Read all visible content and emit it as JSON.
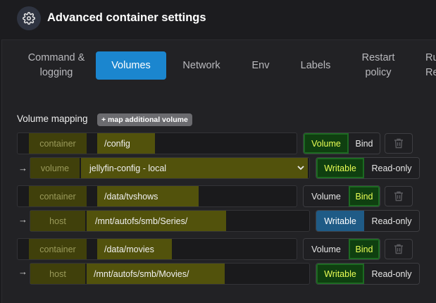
{
  "header": {
    "title": "Advanced container settings",
    "icon": "gear-icon"
  },
  "tabs": [
    {
      "label": "Command &\nlogging",
      "active": false
    },
    {
      "label": "Volumes",
      "active": true
    },
    {
      "label": "Network",
      "active": false
    },
    {
      "label": "Env",
      "active": false
    },
    {
      "label": "Labels",
      "active": false
    },
    {
      "label": "Restart\npolicy",
      "active": false
    },
    {
      "label": "Ru\nRe",
      "active": false
    }
  ],
  "volumes": {
    "section_label": "Volume mapping",
    "add_label": "+ map additional volume",
    "mappings": [
      {
        "container_label": "container",
        "container_path": "/config",
        "type_options": [
          "Volume",
          "Bind"
        ],
        "type_selected": "Volume",
        "source_label": "volume",
        "source_value": "jellyfin-config - local",
        "mode_options": [
          "Writable",
          "Read-only"
        ],
        "mode_selected": "Writable"
      },
      {
        "container_label": "container",
        "container_path": "/data/tvshows",
        "type_options": [
          "Volume",
          "Bind"
        ],
        "type_selected": "Bind",
        "source_label": "host",
        "source_value": "/mnt/autofs/smb/Series/",
        "mode_options": [
          "Writable",
          "Read-only"
        ],
        "mode_selected": "Writable"
      },
      {
        "container_label": "container",
        "container_path": "/data/movies",
        "type_options": [
          "Volume",
          "Bind"
        ],
        "type_selected": "Bind",
        "source_label": "host",
        "source_value": "/mnt/autofs/smb/Movies/",
        "mode_options": [
          "Writable",
          "Read-only"
        ],
        "mode_selected": "Writable"
      }
    ]
  },
  "colors": {
    "accent": "#1b86cf",
    "selected_green": "#0f3f10",
    "highlight_yellow": "#eaff54"
  }
}
